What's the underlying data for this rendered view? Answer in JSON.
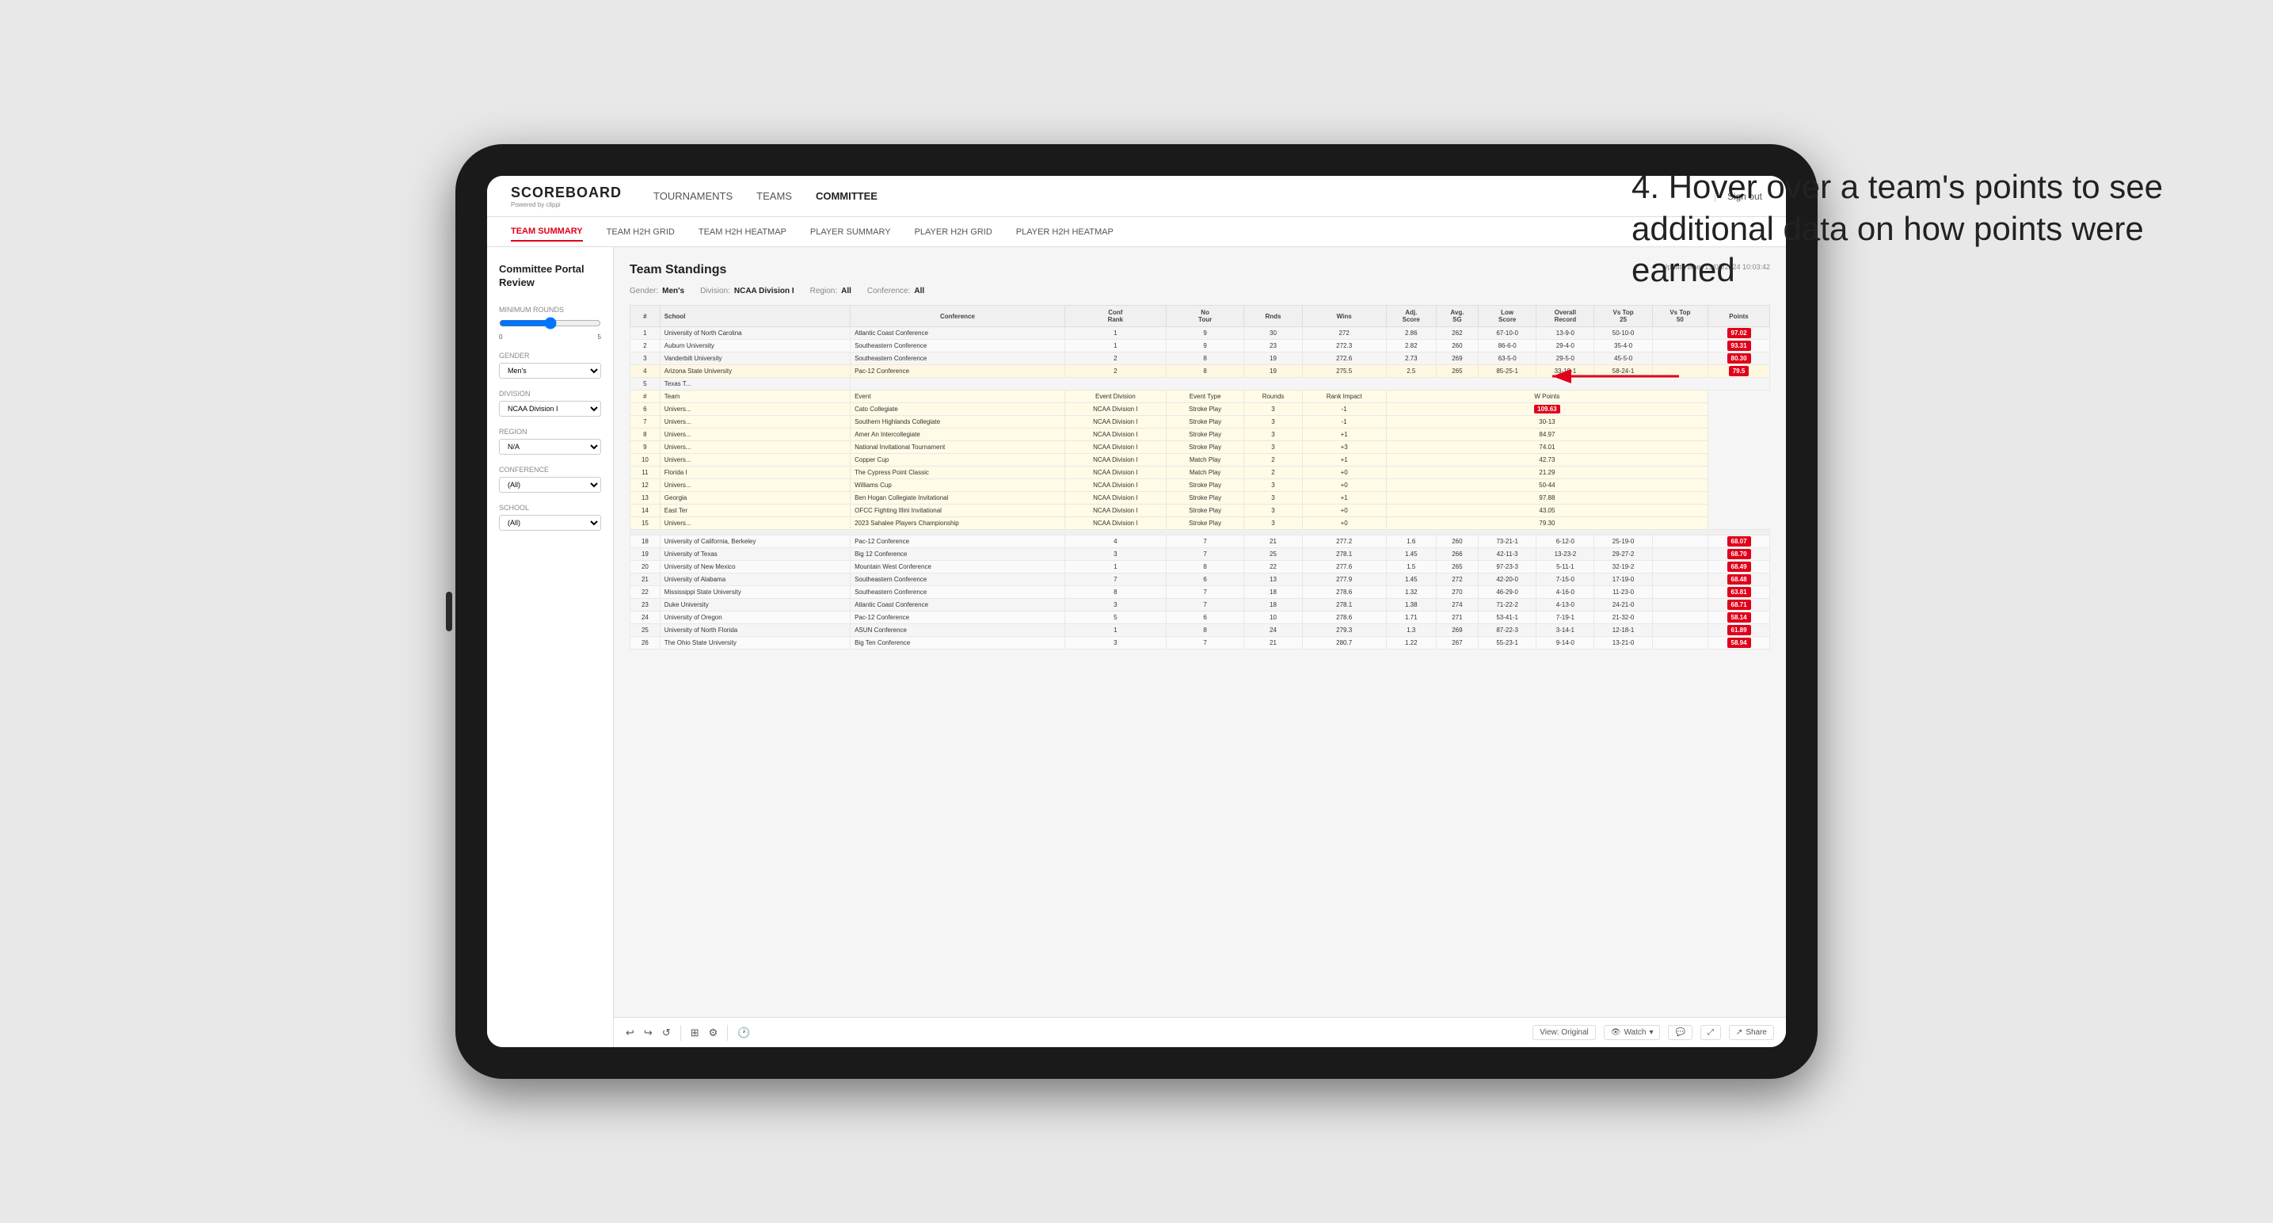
{
  "app": {
    "logo": "SCOREBOARD",
    "logo_sub": "Powered by clippi"
  },
  "nav": {
    "links": [
      "TOURNAMENTS",
      "TEAMS",
      "COMMITTEE"
    ],
    "active": "COMMITTEE",
    "sign_out": "Sign out"
  },
  "sub_nav": {
    "links": [
      "TEAM SUMMARY",
      "TEAM H2H GRID",
      "TEAM H2H HEATMAP",
      "PLAYER SUMMARY",
      "PLAYER H2H GRID",
      "PLAYER H2H HEATMAP"
    ],
    "active": "TEAM SUMMARY"
  },
  "sidebar": {
    "title": "Committee Portal Review",
    "sections": [
      {
        "label": "Minimum Rounds",
        "type": "slider",
        "value": "5",
        "min": "0",
        "max": "10"
      },
      {
        "label": "Gender",
        "type": "select",
        "value": "Men's"
      },
      {
        "label": "Division",
        "type": "select",
        "value": "NCAA Division I"
      },
      {
        "label": "Region",
        "type": "select",
        "value": "N/A"
      },
      {
        "label": "Conference",
        "type": "select",
        "value": "(All)"
      },
      {
        "label": "School",
        "type": "select",
        "value": "(All)"
      }
    ]
  },
  "report": {
    "title": "Team Standings",
    "update_time": "Update time: 13/03/2024 10:03:42",
    "filters": {
      "gender_label": "Gender:",
      "gender_value": "Men's",
      "division_label": "Division:",
      "division_value": "NCAA Division I",
      "region_label": "Region:",
      "region_value": "All",
      "conference_label": "Conference:",
      "conference_value": "All"
    },
    "table_headers": [
      "#",
      "School",
      "Conference",
      "Conf Rank",
      "No Tour",
      "Rnds",
      "Wins",
      "Adj. Score",
      "Avg. SG",
      "Low Score",
      "Overall Record",
      "Vs Top 25",
      "Vs Top 50",
      "Points"
    ],
    "rows": [
      {
        "rank": 1,
        "school": "University of North Carolina",
        "conference": "Atlantic Coast Conference",
        "conf_rank": 1,
        "no_tour": 9,
        "rnds": 30,
        "wins": 272.0,
        "avg_score": 2.86,
        "low_score": 262,
        "overall": "67-10-0",
        "vs25": "13-9-0",
        "vs50": "50-10-0",
        "points": "97.02",
        "highlighted": false
      },
      {
        "rank": 2,
        "school": "Auburn University",
        "conference": "Southeastern Conference",
        "conf_rank": 1,
        "no_tour": 9,
        "rnds": 23,
        "wins": 272.3,
        "avg_score": 2.82,
        "low_score": 260,
        "overall": "86-6-0",
        "vs25": "29-4-0",
        "vs50": "35-4-0",
        "points": "93.31",
        "highlighted": false
      },
      {
        "rank": 3,
        "school": "Vanderbilt University",
        "conference": "Southeastern Conference",
        "conf_rank": 2,
        "no_tour": 8,
        "rnds": 19,
        "wins": 272.6,
        "avg_score": 2.73,
        "low_score": 269,
        "overall": "63-5-0",
        "vs25": "29-5-0",
        "vs50": "45-5-0",
        "points": "80.30",
        "highlighted": false
      },
      {
        "rank": 4,
        "school": "Arizona State University",
        "conference": "Pac-12 Conference",
        "conf_rank": 2,
        "no_tour": 8,
        "rnds": 19,
        "wins": 275.5,
        "avg_score": 2.5,
        "low_score": 265,
        "overall": "85-25-1",
        "vs25": "33-19-1",
        "vs50": "58-24-1",
        "points": "79.5",
        "highlighted": true
      },
      {
        "rank": 5,
        "school": "Texas T...",
        "conference": "",
        "conf_rank": "",
        "no_tour": "",
        "rnds": "",
        "wins": "",
        "avg_score": "",
        "low_score": "",
        "overall": "",
        "vs25": "",
        "vs50": "",
        "points": "",
        "highlighted": false
      }
    ],
    "tooltip_headers": [
      "Team",
      "Event",
      "Event Division",
      "Event Type",
      "Rounds",
      "Rank Impact",
      "W Points"
    ],
    "tooltip_rows": [
      {
        "num": 6,
        "team": "Univers...",
        "event": "Cato Collegiate",
        "division": "NCAA Division I",
        "type": "Stroke Play",
        "rounds": 3,
        "rank_impact": -1,
        "points": "109.63"
      },
      {
        "num": 7,
        "team": "Univers...",
        "event": "Southern Highlands Collegiate",
        "division": "NCAA Division I",
        "type": "Stroke Play",
        "rounds": 3,
        "rank_impact": -1,
        "points": "30-13"
      },
      {
        "num": 8,
        "team": "Univers...",
        "event": "Amer An Intercollegiate",
        "division": "NCAA Division I",
        "type": "Stroke Play",
        "rounds": 3,
        "rank_impact": "+1",
        "points": "84.97"
      },
      {
        "num": 9,
        "team": "Univers...",
        "event": "National Invitational Tournament",
        "division": "NCAA Division I",
        "type": "Stroke Play",
        "rounds": 3,
        "rank_impact": "+3",
        "points": "74.01"
      },
      {
        "num": 10,
        "team": "Univers...",
        "event": "Copper Cup",
        "division": "NCAA Division I",
        "type": "Match Play",
        "rounds": 2,
        "rank_impact": "+1",
        "points": "42.73"
      },
      {
        "num": 11,
        "team": "Florida I",
        "event": "The Cypress Point Classic",
        "division": "NCAA Division I",
        "type": "Match Play",
        "rounds": 2,
        "rank_impact": "+0",
        "points": "21.29"
      },
      {
        "num": 12,
        "team": "Univers...",
        "event": "Williams Cup",
        "division": "NCAA Division I",
        "type": "Stroke Play",
        "rounds": 3,
        "rank_impact": "+0",
        "points": "50-44"
      },
      {
        "num": 13,
        "team": "Georgia",
        "event": "Ben Hogan Collegiate Invitational",
        "division": "NCAA Division I",
        "type": "Stroke Play",
        "rounds": 3,
        "rank_impact": "+1",
        "points": "97.88"
      },
      {
        "num": 14,
        "team": "East Ter",
        "event": "OFCC Fighting Illini Invitational",
        "division": "NCAA Division I",
        "type": "Stroke Play",
        "rounds": 3,
        "rank_impact": "+0",
        "points": "43.05"
      },
      {
        "num": 15,
        "team": "Univers...",
        "event": "2023 Sahalee Players Championship",
        "division": "NCAA Division I",
        "type": "Stroke Play",
        "rounds": 3,
        "rank_impact": "+0",
        "points": "79.30"
      }
    ],
    "bottom_rows": [
      {
        "rank": 18,
        "school": "University of California, Berkeley",
        "conference": "Pac-12 Conference",
        "conf_rank": 4,
        "no_tour": 7,
        "rnds": 21,
        "wins": 277.2,
        "avg_score": 1.6,
        "low_score": 260,
        "overall": "73-21-1",
        "vs25": "6-12-0",
        "vs50": "25-19-0",
        "points": "68.07"
      },
      {
        "rank": 19,
        "school": "University of Texas",
        "conference": "Big 12 Conference",
        "conf_rank": 3,
        "no_tour": 7,
        "rnds": 25,
        "wins": 278.1,
        "avg_score": 1.45,
        "low_score": 266,
        "overall": "42-11-3",
        "vs25": "13-23-2",
        "vs50": "29-27-2",
        "points": "68.70"
      },
      {
        "rank": 20,
        "school": "University of New Mexico",
        "conference": "Mountain West Conference",
        "conf_rank": 1,
        "no_tour": 8,
        "rnds": 22,
        "wins": 277.6,
        "avg_score": 1.5,
        "low_score": 265,
        "overall": "97-23-3",
        "vs25": "5-11-1",
        "vs50": "32-19-2",
        "points": "68.49"
      },
      {
        "rank": 21,
        "school": "University of Alabama",
        "conference": "Southeastern Conference",
        "conf_rank": 7,
        "no_tour": 6,
        "rnds": 13,
        "wins": 277.9,
        "avg_score": 1.45,
        "low_score": 272,
        "overall": "42-20-0",
        "vs25": "7-15-0",
        "vs50": "17-19-0",
        "points": "68.48"
      },
      {
        "rank": 22,
        "school": "Mississippi State University",
        "conference": "Southeastern Conference",
        "conf_rank": 8,
        "no_tour": 7,
        "rnds": 18,
        "wins": 278.6,
        "avg_score": 1.32,
        "low_score": 270,
        "overall": "46-29-0",
        "vs25": "4-16-0",
        "vs50": "11-23-0",
        "points": "63.81"
      },
      {
        "rank": 23,
        "school": "Duke University",
        "conference": "Atlantic Coast Conference",
        "conf_rank": 3,
        "no_tour": 7,
        "rnds": 18,
        "wins": 278.1,
        "avg_score": 1.38,
        "low_score": 274,
        "overall": "71-22-2",
        "vs25": "4-13-0",
        "vs50": "24-21-0",
        "points": "68.71"
      },
      {
        "rank": 24,
        "school": "University of Oregon",
        "conference": "Pac-12 Conference",
        "conf_rank": 5,
        "no_tour": 6,
        "rnds": 10,
        "wins": 278.6,
        "avg_score": 1.71,
        "low_score": 271,
        "overall": "53-41-1",
        "vs25": "7-19-1",
        "vs50": "21-32-0",
        "points": "58.14"
      },
      {
        "rank": 25,
        "school": "University of North Florida",
        "conference": "ASUN Conference",
        "conf_rank": 1,
        "no_tour": 8,
        "rnds": 24,
        "wins": 279.3,
        "avg_score": 1.3,
        "low_score": 269,
        "overall": "87-22-3",
        "vs25": "3-14-1",
        "vs50": "12-18-1",
        "points": "61.89"
      },
      {
        "rank": 26,
        "school": "The Ohio State University",
        "conference": "Big Ten Conference",
        "conf_rank": 3,
        "no_tour": 7,
        "rnds": 21,
        "wins": 280.7,
        "avg_score": 1.22,
        "low_score": 267,
        "overall": "55-23-1",
        "vs25": "9-14-0",
        "vs50": "13-21-0",
        "points": "58.94"
      }
    ]
  },
  "toolbar": {
    "view_label": "View: Original",
    "watch_label": "Watch",
    "share_label": "Share"
  },
  "annotation": {
    "text": "4. Hover over a team's points to see additional data on how points were earned"
  }
}
